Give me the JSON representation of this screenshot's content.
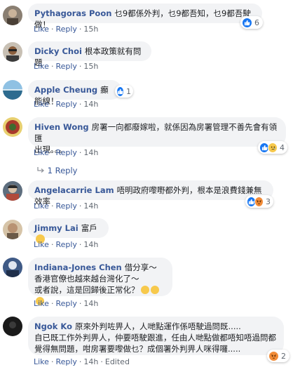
{
  "comments": [
    {
      "author": "Pythagoras Poon",
      "text": "乜9都係外判，乜9都吾知，乜9都吾駛做！",
      "actions": {
        "like": "Like",
        "reply": "Reply",
        "time": "15h"
      },
      "reactions": {
        "count": "6",
        "types": [
          "like"
        ]
      }
    },
    {
      "author": "Dicky Choi",
      "text": "根本政策就有問題",
      "actions": {
        "like": "Like",
        "reply": "Reply",
        "time": "15h"
      }
    },
    {
      "author": "Apple Cheung",
      "text": "癲能線！",
      "actions": {
        "like": "Like",
        "reply": "Reply",
        "time": "14h"
      },
      "reactions": {
        "count": "1",
        "types": [
          "like"
        ]
      }
    },
    {
      "author": "Hiven Wong",
      "text_line1": "房署一向都廢嫁啦，就係因為房署管理不善先會有領匯",
      "text_line2": "出現。。。",
      "actions": {
        "like": "Like",
        "reply": "Reply",
        "time": "14h"
      },
      "reactions": {
        "count": "4",
        "types": [
          "like",
          "sad"
        ]
      },
      "reply_thread": "1 Reply"
    },
    {
      "author": "Angelacarrie Lam",
      "text": "唔明政府嚟嘢都外判，根本是浪費錢兼無效率",
      "actions": {
        "like": "Like",
        "reply": "Reply",
        "time": "14h"
      },
      "reactions": {
        "count": "3",
        "types": [
          "like",
          "angry"
        ]
      }
    },
    {
      "author": "Jimmy Lai",
      "text": "富戶",
      "actions": {
        "like": "Like",
        "reply": "Reply",
        "time": "14h"
      }
    },
    {
      "author": "Indiana-Jones Chen",
      "text_line1": "借分享～",
      "text_line2": "香港官僚也越來越台灣化了～",
      "text_line3": "或者說，這是回歸後正常化？",
      "actions": {
        "like": "Like",
        "reply": "Reply",
        "time": "14h"
      }
    },
    {
      "author": "Ngok Ko",
      "text_line1": "原來外判咗畀人，人哋點運作係唔駛過問既.....",
      "text_line2": "自已既工作外判畀人，仲要唔駛跟進，任由人哋點做都唔知唔過問都",
      "text_line3": "覺得無問題，咁房署要嚟做乜？成個署外判畀人咪得囉.....",
      "actions": {
        "like": "Like",
        "reply": "Reply",
        "time": "14h",
        "edited": "Edited"
      },
      "reactions": {
        "count": "2",
        "types": [
          "angry"
        ]
      }
    }
  ],
  "colors": {
    "link": "#385898",
    "bubble": "#f2f3f5",
    "like": "#1877f2",
    "meta": "#606770"
  }
}
